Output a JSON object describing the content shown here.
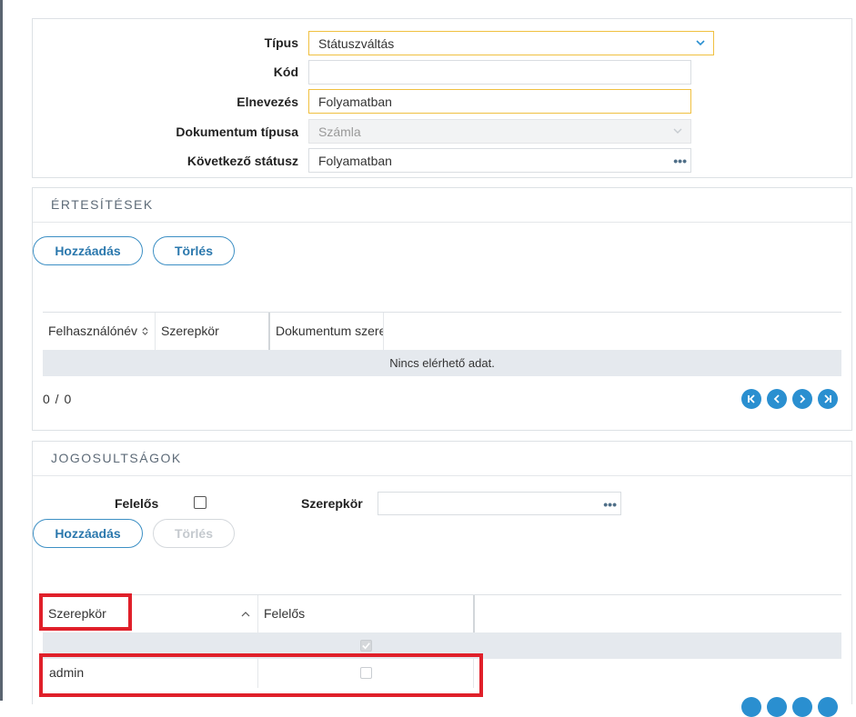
{
  "form": {
    "tipus": {
      "label": "Típus",
      "value": "Státuszváltás"
    },
    "kod": {
      "label": "Kód",
      "value": ""
    },
    "elnevezes": {
      "label": "Elnevezés",
      "value": "Folyamatban"
    },
    "dok_tipus": {
      "label": "Dokumentum típusa",
      "value": "Számla"
    },
    "kov_status": {
      "label": "Következő státusz",
      "value": "Folyamatban"
    }
  },
  "ertesitesek": {
    "title": "ÉRTESÍTÉSEK",
    "add_label": "Hozzáadás",
    "delete_label": "Törlés",
    "columns": [
      "Felhasználónév",
      "Szerepkör",
      "Dokumentum szerepkör"
    ],
    "empty_text": "Nincs elérhető adat.",
    "pager": "0 / 0"
  },
  "jogosultsagok": {
    "title": "JOGOSULTSÁGOK",
    "felelos_label": "Felelős",
    "felelos_checked": false,
    "szerepkor_label": "Szerepkör",
    "szerepkor_value": "",
    "add_label": "Hozzáadás",
    "delete_label": "Törlés",
    "columns": [
      "Szerepkör",
      "Felelős"
    ],
    "rows": [
      {
        "szerepkor": "",
        "felelos": true
      },
      {
        "szerepkor": "admin",
        "felelos": false
      }
    ]
  },
  "icons": {
    "dropdown": "chevron-down-icon",
    "browse": "ellipsis-icon",
    "sort": "sort-asc-icon",
    "pager": [
      "first-page-icon",
      "prev-page-icon",
      "next-page-icon",
      "last-page-icon"
    ]
  },
  "colors": {
    "accent": "#2a8fd0",
    "focus": "#f0c040",
    "highlight": "#e0202a"
  }
}
